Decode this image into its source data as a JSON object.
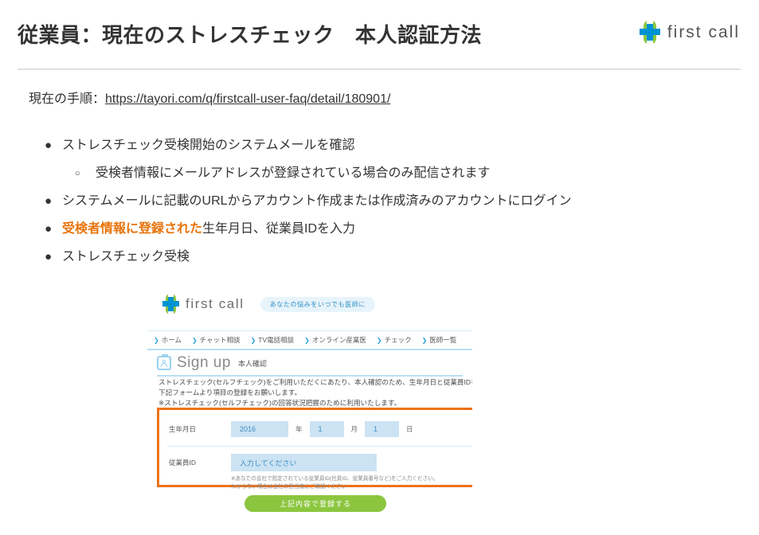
{
  "slide": {
    "title": "従業員：現在のストレスチェック　本人認証方法",
    "brand_name": "first call",
    "brand_green": "#8CC63F",
    "brand_blue": "#0093D3",
    "highlight_orange": "#E8740C"
  },
  "intro": {
    "prefix": "現在の手順：",
    "url": "https://tayori.com/q/firstcall-user-faq/detail/180901/"
  },
  "bullets": [
    {
      "level": 1,
      "marker": "●",
      "text": "ストレスチェック受検開始のシステムメールを確認"
    },
    {
      "level": 2,
      "marker": "○",
      "text": "受検者情報にメールアドレスが登録されている場合のみ配信されます"
    },
    {
      "level": 1,
      "marker": "●",
      "text": "システムメールに記載のURLからアカウント作成または作成済みのアカウントにログイン"
    },
    {
      "level": 1,
      "marker": "●",
      "highlight": "受検者情報に登録された",
      "text": "生年月日、従業員IDを入力"
    },
    {
      "level": 1,
      "marker": "●",
      "text": "ストレスチェック受検"
    }
  ],
  "screenshot": {
    "brand_name": "first call",
    "tagline": "あなたの悩みをいつでも医師に",
    "nav": [
      {
        "label": "ホーム"
      },
      {
        "label": "チャット相談"
      },
      {
        "label": "TV電話相談"
      },
      {
        "label": "オンライン産業医"
      },
      {
        "label": "チェック"
      },
      {
        "label": "医師一覧"
      }
    ],
    "signup": {
      "title": "Sign up",
      "subtitle": "本人確認",
      "paragraph_line1": "ストレスチェック(セルフチェック)をご利用いただくにあたり、本人確認のため、生年月日と従業員IDをご登",
      "paragraph_line2": "下記フォームより項目の登録をお願いします。",
      "paragraph_line3": "※ストレスチェック(セルフチェック)の回答状況把握のために利用いたします。"
    },
    "form": {
      "birthdate_label": "生年月日",
      "year_value": "2016",
      "year_unit": "年",
      "month_value": "1",
      "month_unit": "月",
      "day_value": "1",
      "day_unit": "日",
      "employee_id_label": "従業員ID",
      "employee_id_placeholder": "入力してください",
      "help_line1": "※あなたの会社で指定されている従業員ID(社員ID、従業員番号など)をご入力ください。",
      "help_line2": "わからない場合は会社の担当者にご確認ください",
      "submit_label": "上記内容で登録する",
      "highlight_border_color": "#ED7117",
      "input_bg_color": "#CBE3F3",
      "submit_bg_color": "#8CC63F"
    }
  }
}
